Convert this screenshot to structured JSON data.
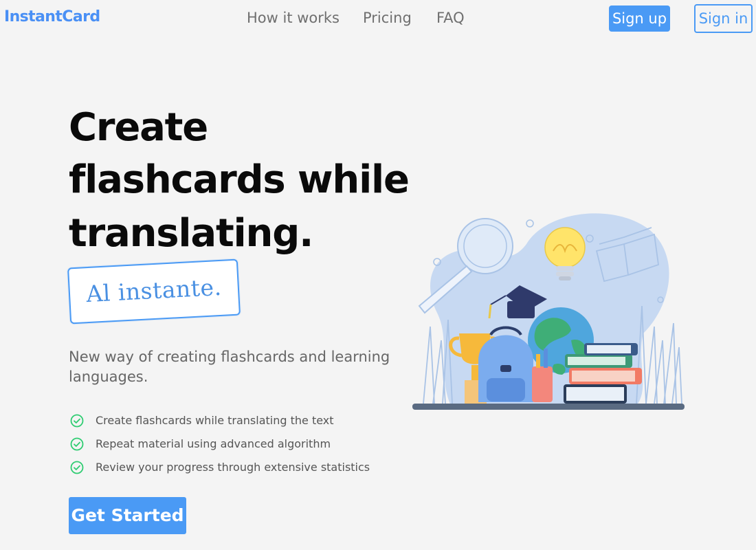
{
  "header": {
    "logo": "InstantCard",
    "nav": [
      {
        "label": "How it works"
      },
      {
        "label": "Pricing"
      },
      {
        "label": "FAQ"
      }
    ],
    "sign_up": "Sign up",
    "sign_in": "Sign in"
  },
  "hero": {
    "title_lines": [
      "Create",
      "flashcards while",
      "translating."
    ],
    "badge": "Al instante.",
    "subtitle": "New way of creating flashcards and learning languages.",
    "features": [
      "Create flashcards while translating the text",
      "Repeat material using advanced algorithm",
      "Review your progress through extensive statistics"
    ],
    "cta": "Get Started"
  },
  "colors": {
    "accent": "#4a9af5",
    "check": "#2ecc71",
    "background": "#f4f4f4",
    "heading": "#0a0a0a",
    "muted": "#6f6f6f"
  },
  "icons": {
    "feature": "check-circle-icon",
    "illustration": "education-illustration"
  }
}
